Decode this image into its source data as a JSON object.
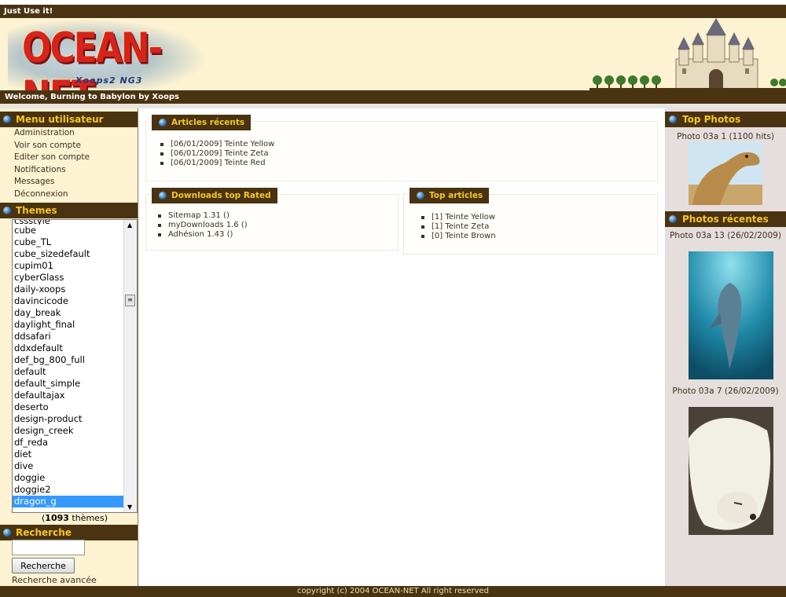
{
  "site": {
    "topbar_text": "Just Use it!",
    "logo_text": "OCEAN-NET",
    "logo_subtitle": "Xoops2 NG3",
    "welcome_text": "Welcome, Burning to Babylon by Xoops",
    "footer_text": "copyright (c) 2004 OCEAN-NET All right reserved"
  },
  "usermenu": {
    "title": "Menu utilisateur",
    "items": [
      "Administration",
      "Voir son compte",
      "Editer son compte",
      "Notifications",
      "Messages",
      "Déconnexion"
    ]
  },
  "themes": {
    "title": "Themes",
    "items": [
      "cssstyle",
      "cube",
      "cube_TL",
      "cube_sizedefault",
      "cupim01",
      "cyberGlass",
      "daily-xoops",
      "davincicode",
      "day_break",
      "daylight_final",
      "ddsafari",
      "ddxdefault",
      "def_bg_800_full",
      "default",
      "default_simple",
      "defaultajax",
      "deserto",
      "design-product",
      "design_creek",
      "df_reda",
      "diet",
      "dive",
      "doggie",
      "doggie2",
      "dragon_g"
    ],
    "selected": "dragon_g",
    "count_number": "1093",
    "count_suffix": " thèmes"
  },
  "search": {
    "title": "Recherche",
    "input_value": "",
    "button_label": "Recherche",
    "advanced_link": "Recherche avancée"
  },
  "articles_recents": {
    "title": "Articles récents",
    "items": [
      "[06/01/2009] Teinte Yellow",
      "[06/01/2009] Teinte Zeta",
      "[06/01/2009] Teinte Red"
    ]
  },
  "downloads_top": {
    "title": "Downloads top Rated",
    "items": [
      "Sitemap 1.31 ()",
      "myDownloads 1.6 ()",
      "Adhésion 1.43 ()"
    ]
  },
  "top_articles": {
    "title": "Top articles",
    "items": [
      "[1] Teinte Yellow",
      "[1] Teinte Zeta",
      "[0] Teinte Brown"
    ]
  },
  "top_photos": {
    "title": "Top Photos",
    "photos": [
      {
        "caption": "Photo 03a 1 (1100 hits)",
        "subject": "camel"
      }
    ]
  },
  "photos_recentes": {
    "title": "Photos récentes",
    "photos": [
      {
        "caption": "Photo 03a 13 (26/02/2009)",
        "subject": "dolphin"
      },
      {
        "caption": "Photo 03a 7 (26/02/2009)",
        "subject": "polar-bear"
      }
    ]
  },
  "colors": {
    "bar_brown": "#4a3310",
    "title_yellow": "#f5c62a",
    "cream": "#fdf3d2",
    "selection_blue": "#3399ff"
  }
}
